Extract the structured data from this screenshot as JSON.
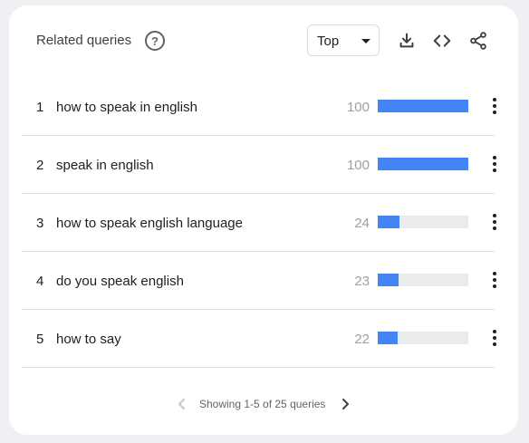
{
  "widget": {
    "title": "Related queries",
    "help_icon": "question-circle-icon",
    "select": {
      "value": "Top"
    },
    "tools": [
      "download-icon",
      "embed-code-icon",
      "share-icon"
    ],
    "accent_color": "#4285f4",
    "track_color": "#ebebeb"
  },
  "rows": [
    {
      "rank": "1",
      "query": "how to speak in english",
      "value": "100",
      "fill": 1.0
    },
    {
      "rank": "2",
      "query": "speak in english",
      "value": "100",
      "fill": 1.0
    },
    {
      "rank": "3",
      "query": "how to speak english language",
      "value": "24",
      "fill": 0.24
    },
    {
      "rank": "4",
      "query": "do you speak english",
      "value": "23",
      "fill": 0.23
    },
    {
      "rank": "5",
      "query": "how to say",
      "value": "22",
      "fill": 0.22
    }
  ],
  "pagination": {
    "text": "Showing 1-5 of 25 queries",
    "prev_icon": "chevron-left-icon",
    "next_icon": "chevron-right-icon"
  }
}
